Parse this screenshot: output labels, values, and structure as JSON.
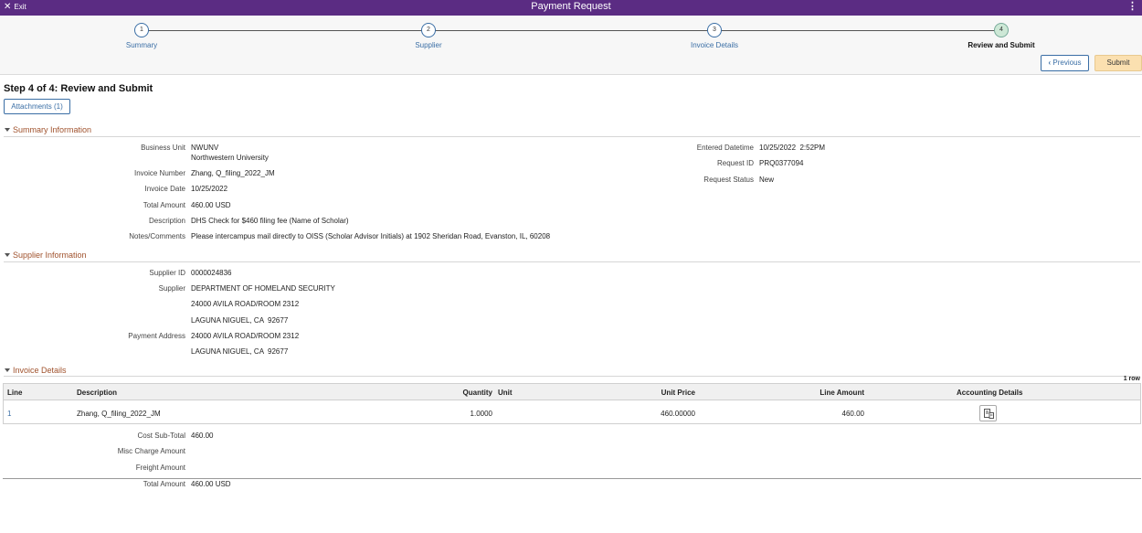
{
  "header": {
    "exit_label": "Exit",
    "title": "Payment Request"
  },
  "train": {
    "steps": [
      {
        "num": "1",
        "label": "Summary"
      },
      {
        "num": "2",
        "label": "Supplier"
      },
      {
        "num": "3",
        "label": "Invoice Details"
      },
      {
        "num": "4",
        "label": "Review and Submit"
      }
    ],
    "previous_label": "Previous",
    "submit_label": "Submit"
  },
  "page": {
    "heading": "Step 4 of 4: Review and Submit",
    "attachments_label": "Attachments (1)"
  },
  "summary": {
    "section_title": "Summary Information",
    "business_unit_label": "Business Unit",
    "business_unit": "NWUNV",
    "business_unit_desc": "Northwestern University",
    "invoice_number_label": "Invoice Number",
    "invoice_number": "Zhang, Q_filing_2022_JM",
    "invoice_date_label": "Invoice Date",
    "invoice_date": "10/25/2022",
    "total_amount_label": "Total Amount",
    "total_amount": "460.00 USD",
    "description_label": "Description",
    "description": "DHS Check for $460 filing fee (Name of Scholar)",
    "notes_label": "Notes/Comments",
    "notes": "Please intercampus mail directly to OISS (Scholar Advisor Initials) at 1902 Sheridan Road, Evanston, IL, 60208",
    "entered_datetime_label": "Entered Datetime",
    "entered_datetime": "10/25/2022  2:52PM",
    "request_id_label": "Request ID",
    "request_id": "PRQ0377094",
    "request_status_label": "Request Status",
    "request_status": "New"
  },
  "supplier": {
    "section_title": "Supplier Information",
    "supplier_id_label": "Supplier ID",
    "supplier_id": "0000024836",
    "supplier_label": "Supplier",
    "supplier_name": "DEPARTMENT OF HOMELAND SECURITY",
    "supplier_addr1": "24000 AVILA ROAD/ROOM 2312",
    "supplier_addr2": "LAGUNA NIGUEL, CA  92677",
    "payment_address_label": "Payment Address",
    "payment_addr1": "24000 AVILA ROAD/ROOM 2312",
    "payment_addr2": "LAGUNA NIGUEL, CA  92677"
  },
  "invoice": {
    "section_title": "Invoice Details",
    "row_count": "1 row",
    "columns": {
      "line": "Line",
      "description": "Description",
      "quantity": "Quantity",
      "unit": "Unit",
      "unit_price": "Unit Price",
      "line_amount": "Line Amount",
      "accounting": "Accounting Details"
    },
    "rows": [
      {
        "line": "1",
        "description": "Zhang, Q_filing_2022_JM",
        "quantity": "1.0000",
        "unit": "",
        "unit_price": "460.00000",
        "line_amount": "460.00"
      }
    ],
    "cost_subtotal_label": "Cost Sub-Total",
    "cost_subtotal": "460.00",
    "misc_charge_label": "Misc Charge Amount",
    "freight_label": "Freight Amount",
    "total_label": "Total Amount",
    "total": "460.00 USD"
  }
}
